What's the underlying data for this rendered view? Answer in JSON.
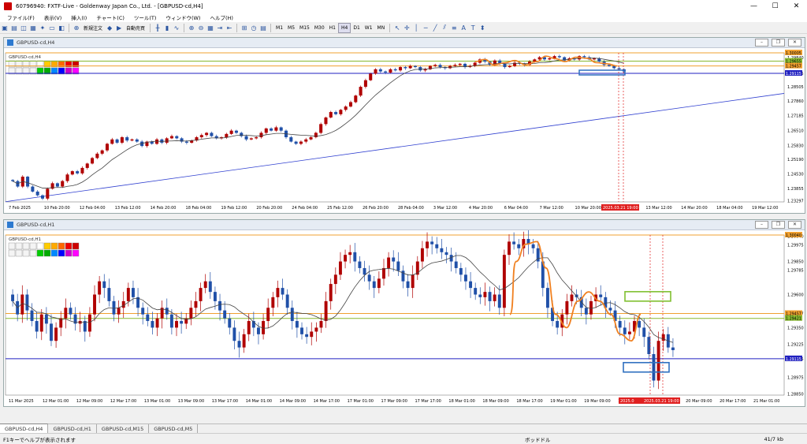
{
  "window": {
    "title": "60796940: FXTF-Live - Goldenway Japan Co., Ltd. - [GBPUSD-cd,H4]",
    "controls": [
      "—",
      "☐",
      "✕"
    ]
  },
  "menu": [
    "ファイル(F)",
    "表示(V)",
    "挿入(I)",
    "チャート(C)",
    "ツール(T)",
    "ウィンドウ(W)",
    "ヘルプ(H)"
  ],
  "toolbar": {
    "new_order": "新規注文",
    "auto_trade": "自動売買",
    "timeframes": [
      "M1",
      "M5",
      "M15",
      "M30",
      "H1",
      "H4",
      "D1",
      "W1",
      "MN"
    ],
    "active_tf": "H4"
  },
  "top_chart": {
    "window_title": "GBPUSD-cd,H4",
    "inner_label": "GBPUSD-cd,H4",
    "price_min": 1.2325,
    "price_max": 1.3005,
    "price_ticks": [
      "1.29840",
      "1.29115",
      "1.28505",
      "1.27860",
      "1.27185",
      "1.26510",
      "1.25830",
      "1.25190",
      "1.24530",
      "1.23855",
      "1.23297"
    ],
    "ticks_values": [
      1.2984,
      1.29115,
      1.28505,
      1.2786,
      1.27185,
      1.2651,
      1.2583,
      1.2519,
      1.2453,
      1.23855,
      1.23297
    ],
    "time_labels": [
      "7 Feb 2025",
      "10 Feb 20:00",
      "12 Feb 04:00",
      "13 Feb 12:00",
      "14 Feb 20:00",
      "18 Feb 04:00",
      "19 Feb 12:00",
      "20 Feb 20:00",
      "24 Feb 04:00",
      "25 Feb 12:00",
      "26 Feb 20:00",
      "28 Feb 04:00",
      "3 Mar 12:00",
      "4 Mar 20:00",
      "6 Mar 04:00",
      "7 Mar 12:00",
      "10 Mar 20:00",
      "12 Mar 04:00",
      "13 Mar 12:00",
      "14 Mar 20:00",
      "18 Mar 04:00",
      "19 Mar 12:00"
    ],
    "red_time_label": "2025.03.21 19:00",
    "hlines": [
      {
        "price": 1.3005,
        "color": "#f0a030",
        "label": "1.30005"
      },
      {
        "price": 1.2967,
        "color": "#88b830",
        "label": "1.29655"
      },
      {
        "price": 1.2945,
        "color": "#f0a030",
        "label": "1.29457"
      },
      {
        "price": 1.29115,
        "color": "#2020c0",
        "label": "1.29115"
      }
    ],
    "trendline": {
      "from": 1.2326,
      "to": 1.282
    },
    "closes": [
      1.242,
      1.2395,
      1.244,
      1.2395,
      1.2372,
      1.2355,
      1.234,
      1.2385,
      1.241,
      1.2395,
      1.242,
      1.245,
      1.2465,
      1.2455,
      1.248,
      1.25,
      1.2525,
      1.2545,
      1.256,
      1.259,
      1.261,
      1.2595,
      1.262,
      1.2605,
      1.261,
      1.26,
      1.258,
      1.26,
      1.259,
      1.261,
      1.2595,
      1.2615,
      1.2625,
      1.2615,
      1.26,
      1.2595,
      1.2605,
      1.262,
      1.263,
      1.264,
      1.2625,
      1.2615,
      1.262,
      1.2635,
      1.265,
      1.264,
      1.2625,
      1.261,
      1.2615,
      1.262,
      1.264,
      1.266,
      1.265,
      1.2665,
      1.265,
      1.262,
      1.26,
      1.259,
      1.26,
      1.261,
      1.262,
      1.264,
      1.268,
      1.271,
      1.2735,
      1.2725,
      1.2745,
      1.276,
      1.278,
      1.281,
      1.285,
      1.288,
      1.291,
      1.293,
      1.292,
      1.2915,
      1.293,
      1.2925,
      1.294,
      1.2935,
      1.2945,
      1.294,
      1.2925,
      1.293,
      1.2945,
      1.295,
      1.294,
      1.2935,
      1.2945,
      1.295,
      1.2955,
      1.294,
      1.2945,
      1.296,
      1.2975,
      1.2965,
      1.295,
      1.297,
      1.2955,
      1.294,
      1.2945,
      1.296,
      1.2955,
      1.295,
      1.2965,
      1.2975,
      1.2985,
      1.2975,
      1.298,
      1.299,
      1.2985,
      1.297,
      1.298,
      1.2975,
      1.299,
      1.2985,
      1.2975,
      1.298,
      1.2965,
      1.295,
      1.2945,
      1.2935,
      1.293,
      1.292
    ]
  },
  "bottom_chart": {
    "window_title": "GBPUSD-cd,H1",
    "inner_label": "GBPUSD-cd,H1",
    "price_min": 1.2884,
    "price_max": 1.3005,
    "price_ticks": [
      "1.30040",
      "1.29975",
      "1.29850",
      "1.29785",
      "1.29600",
      "1.29457",
      "1.29350",
      "1.29225",
      "1.29115",
      "1.28975",
      "1.28850"
    ],
    "ticks_values": [
      1.3004,
      1.29975,
      1.2985,
      1.29785,
      1.296,
      1.29457,
      1.2935,
      1.29225,
      1.29115,
      1.28975,
      1.2885
    ],
    "time_labels": [
      "11 Mar 2025",
      "12 Mar 01:00",
      "12 Mar 09:00",
      "12 Mar 17:00",
      "13 Mar 01:00",
      "13 Mar 09:00",
      "13 Mar 17:00",
      "14 Mar 01:00",
      "14 Mar 09:00",
      "14 Mar 17:00",
      "17 Mar 01:00",
      "17 Mar 09:00",
      "17 Mar 17:00",
      "18 Mar 01:00",
      "18 Mar 09:00",
      "18 Mar 17:00",
      "19 Mar 01:00",
      "19 Mar 09:00",
      "19 Mar 17:00",
      "20 Mar 01:00",
      "20 Mar 09:00",
      "20 Mar 17:00",
      "21 Mar 01:00"
    ],
    "red_time_labels": [
      "2025.0",
      "2025.03.21 19:00"
    ],
    "hlines": [
      {
        "price": 1.3005,
        "color": "#f0a030",
        "label": "1.30040"
      },
      {
        "price": 1.29457,
        "color": "#f0a030",
        "label": "1.29457"
      },
      {
        "price": 1.2942,
        "color": "#88b830",
        "label": "1.29421"
      },
      {
        "price": 1.29115,
        "color": "#2020c0",
        "label": "1.29115"
      }
    ],
    "closes": [
      1.2955,
      1.2945,
      1.296,
      1.2948,
      1.294,
      1.2932,
      1.2945,
      1.2938,
      1.2925,
      1.2935,
      1.2942,
      1.295,
      1.2945,
      1.2938,
      1.294,
      1.2932,
      1.2945,
      1.296,
      1.297,
      1.2965,
      1.2955,
      1.2945,
      1.295,
      1.2955,
      1.2965,
      1.2958,
      1.295,
      1.2945,
      1.294,
      1.2935,
      1.2942,
      1.295,
      1.2945,
      1.2935,
      1.294,
      1.2938,
      1.2942,
      1.295,
      1.2955,
      1.2965,
      1.297,
      1.2962,
      1.2955,
      1.2948,
      1.2942,
      1.2935,
      1.2925,
      1.292,
      1.293,
      1.294,
      1.2935,
      1.293,
      1.294,
      1.295,
      1.2958,
      1.2965,
      1.296,
      1.295,
      1.294,
      1.2935,
      1.293,
      1.2928,
      1.2932,
      1.2935,
      1.294,
      1.2955,
      1.2968,
      1.2975,
      1.2985,
      1.299,
      1.2992,
      1.2985,
      1.298,
      1.2975,
      1.297,
      1.2965,
      1.2972,
      1.298,
      1.2988,
      1.2985,
      1.2978,
      1.297,
      1.2965,
      1.2975,
      1.2985,
      1.2995,
      1.3,
      1.2998,
      1.2995,
      1.2992,
      1.299,
      1.2985,
      1.298,
      1.2975,
      1.297,
      1.2965,
      1.296,
      1.2958,
      1.2962,
      1.2955,
      1.296,
      1.295,
      1.299,
      1.3,
      1.2998,
      1.2995,
      1.3002,
      1.2998,
      1.2995,
      1.2985,
      1.2965,
      1.295,
      1.294,
      1.2935,
      1.2945,
      1.2955,
      1.296,
      1.2958,
      1.295,
      1.2945,
      1.2955,
      1.296,
      1.2958,
      1.295,
      1.2948,
      1.294,
      1.2935,
      1.293,
      1.2932,
      1.294,
      1.2935,
      1.2928,
      1.2915,
      1.2895,
      1.2925,
      1.293,
      1.292,
      1.2918
    ]
  },
  "tabs": [
    "GBPUSD-cd,H4",
    "GBPUSD-cd,H1",
    "GBPUSD-cd,M15",
    "GBPUSD-cd,M5"
  ],
  "status": {
    "help": "F1キーでヘルプが表示されます",
    "profile": "ボッドドル",
    "size": "41/7 kb"
  }
}
